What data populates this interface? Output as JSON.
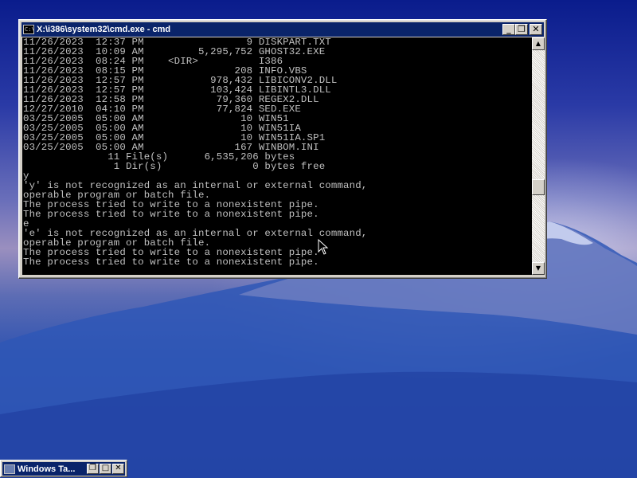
{
  "cmd_window": {
    "title": "X:\\i386\\system32\\cmd.exe - cmd",
    "icon": "cmd-console-icon",
    "buttons": {
      "minimize": "_",
      "restore": "❐",
      "close": "✕"
    },
    "console_lines": [
      "11/26/2023  12:37 PM                 9 DISKPART.TXT",
      "11/26/2023  10:09 AM         5,295,752 GHOST32.EXE",
      "11/26/2023  08:24 PM    <DIR>          I386",
      "11/26/2023  08:15 PM               208 INFO.VBS",
      "11/26/2023  12:57 PM           978,432 LIBICONV2.DLL",
      "11/26/2023  12:57 PM           103,424 LIBINTL3.DLL",
      "11/26/2023  12:58 PM            79,360 REGEX2.DLL",
      "12/27/2010  04:10 PM            77,824 SED.EXE",
      "03/25/2005  05:00 AM                10 WIN51",
      "03/25/2005  05:00 AM                10 WIN51IA",
      "03/25/2005  05:00 AM                10 WIN51IA.SP1",
      "03/25/2005  05:00 AM               167 WINBOM.INI",
      "              11 File(s)      6,535,206 bytes",
      "               1 Dir(s)               0 bytes free",
      "y",
      "'y' is not recognized as an internal or external command,",
      "operable program or batch file.",
      "The process tried to write to a nonexistent pipe.",
      "The process tried to write to a nonexistent pipe.",
      "e",
      "'e' is not recognized as an internal or external command,",
      "operable program or batch file.",
      "The process tried to write to a nonexistent pipe.",
      "The process tried to write to a nonexistent pipe."
    ],
    "scrollbar": {
      "up": "▲",
      "down": "▼"
    }
  },
  "minimized_window": {
    "title": "Windows Ta...",
    "buttons": {
      "restore": "❐",
      "maximize": "□",
      "close": "✕"
    }
  }
}
